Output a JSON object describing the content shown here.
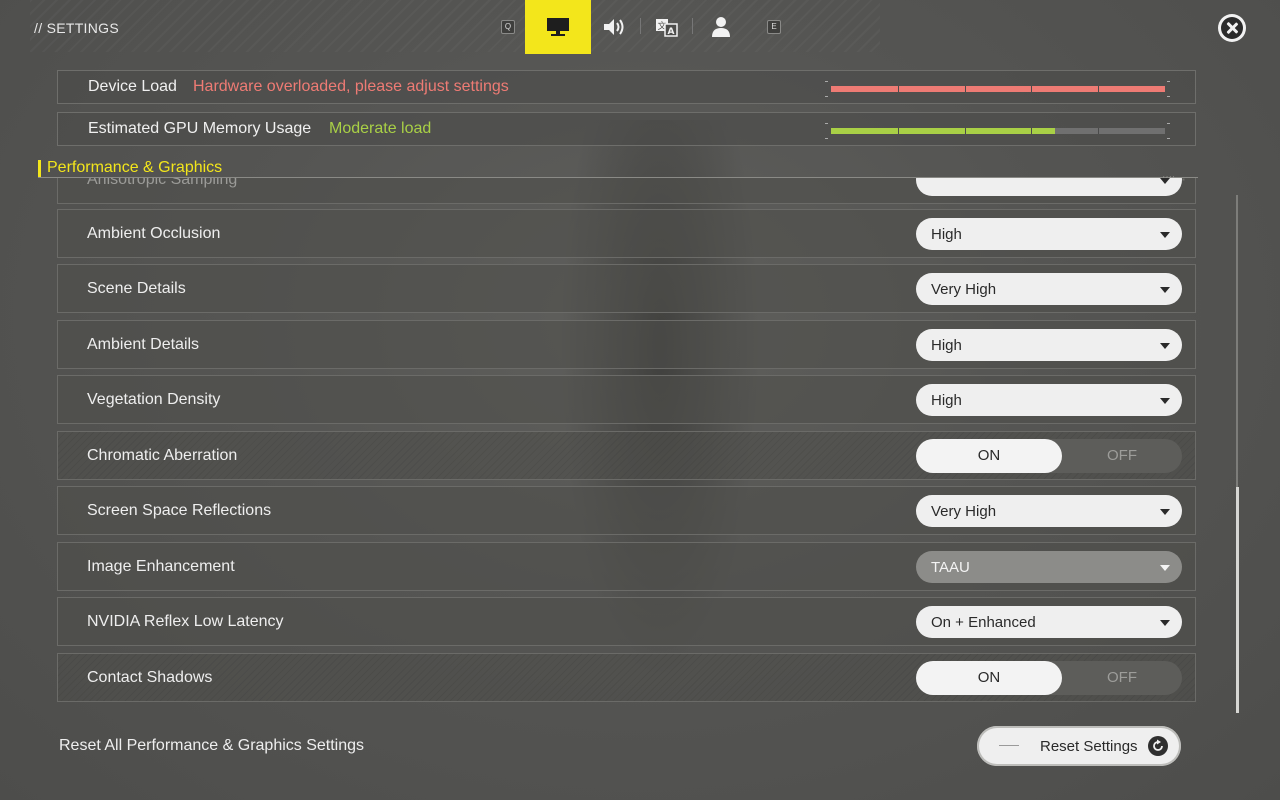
{
  "header": {
    "title": "// SETTINGS",
    "key_left": "Q",
    "key_right": "E",
    "tabs": [
      {
        "icon": "monitor-icon",
        "active": true
      },
      {
        "icon": "speaker-icon",
        "active": false
      },
      {
        "icon": "language-icon",
        "active": false
      },
      {
        "icon": "account-icon",
        "active": false
      }
    ],
    "close_icon": "close-icon"
  },
  "meters": [
    {
      "label": "Device Load",
      "status": "Hardware overloaded, please adjust settings",
      "status_color": "#ee7b74",
      "level": 1.0
    },
    {
      "label": "Estimated GPU Memory Usage",
      "status": "Moderate load",
      "status_color": "#a9d046",
      "level": 0.67
    }
  ],
  "section": {
    "title": "Performance & Graphics"
  },
  "settings": [
    {
      "label": "Anisotropic Sampling",
      "control": "dropdown",
      "value": ""
    },
    {
      "label": "Ambient Occlusion",
      "control": "dropdown",
      "value": "High"
    },
    {
      "label": "Scene Details",
      "control": "dropdown",
      "value": "Very High"
    },
    {
      "label": "Ambient Details",
      "control": "dropdown",
      "value": "High"
    },
    {
      "label": "Vegetation Density",
      "control": "dropdown",
      "value": "High"
    },
    {
      "label": "Chromatic Aberration",
      "control": "toggle",
      "on_label": "ON",
      "off_label": "OFF",
      "value": "ON"
    },
    {
      "label": "Screen Space Reflections",
      "control": "dropdown",
      "value": "Very High"
    },
    {
      "label": "Image Enhancement",
      "control": "dropdown",
      "value": "TAAU",
      "disabled": true
    },
    {
      "label": "NVIDIA Reflex Low Latency",
      "control": "dropdown",
      "value": "On + Enhanced"
    },
    {
      "label": "Contact Shadows",
      "control": "toggle",
      "on_label": "ON",
      "off_label": "OFF",
      "value": "ON"
    }
  ],
  "footer": {
    "label": "Reset All Performance & Graphics Settings",
    "button_label": "Reset Settings",
    "button_icon": "refresh-icon"
  },
  "colors": {
    "accent": "#f3e61b",
    "danger": "#ee7b74",
    "ok": "#a9d046"
  }
}
